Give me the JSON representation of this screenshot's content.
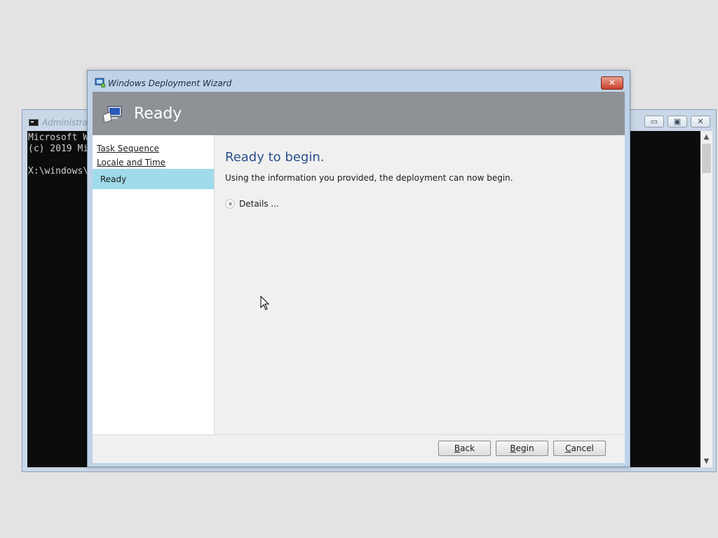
{
  "console": {
    "title": "Administrat",
    "lines": [
      "Microsoft W",
      "(c) 2019 Mi",
      "",
      "X:\\windows\\"
    ],
    "min_glyph": "▭",
    "max_glyph": "▣",
    "close_glyph": "✕"
  },
  "wizard": {
    "title": "Windows Deployment Wizard",
    "close_glyph": "✕",
    "header_title": "Ready",
    "nav": {
      "items": [
        {
          "label": "Task Sequence"
        },
        {
          "label": "Locale and Time"
        },
        {
          "label": "Ready"
        }
      ]
    },
    "content": {
      "heading": "Ready to begin.",
      "description": "Using the information you provided, the deployment can now begin.",
      "details_label": "Details ...",
      "details_glyph": "»"
    },
    "buttons": {
      "back_rest": "ack",
      "back_mnemonic": "B",
      "begin_rest": "egin",
      "begin_mnemonic": "B",
      "cancel_rest": "ancel",
      "cancel_mnemonic": "C"
    }
  },
  "icons": [
    "console-app-icon",
    "wizard-app-icon",
    "computer-icon",
    "expand-details-icon",
    "mouse-cursor-icon"
  ]
}
